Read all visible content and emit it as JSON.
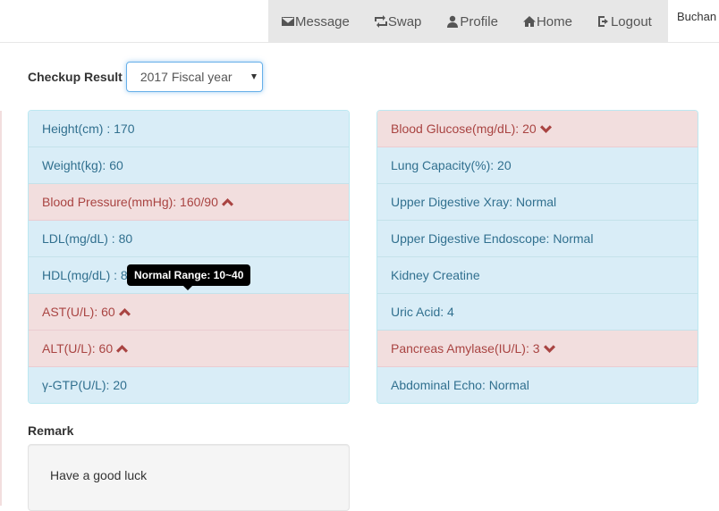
{
  "nav": {
    "items": [
      {
        "label": "Message",
        "icon": "envelope-icon"
      },
      {
        "label": "Swap",
        "icon": "retweet-icon"
      },
      {
        "label": "Profile",
        "icon": "user-icon"
      },
      {
        "label": "Home",
        "icon": "home-icon"
      },
      {
        "label": "Logout",
        "icon": "logout-icon"
      }
    ],
    "user": "Buchan"
  },
  "checkup": {
    "label": "Checkup Result",
    "selected": "2017 Fiscal year"
  },
  "left_list": [
    {
      "text": "Height(cm) : 170",
      "status": "normal"
    },
    {
      "text": "Weight(kg): 60",
      "status": "normal"
    },
    {
      "text": "Blood Pressure(mmHg): 160/90",
      "status": "high"
    },
    {
      "text": "LDL(mg/dL) : 80",
      "status": "normal"
    },
    {
      "text": "HDL(mg/dL) : 8",
      "status": "normal"
    },
    {
      "text": "AST(U/L): 60",
      "status": "high"
    },
    {
      "text": "ALT(U/L): 60",
      "status": "high"
    },
    {
      "text": "γ-GTP(U/L): 20",
      "status": "normal"
    }
  ],
  "right_list": [
    {
      "text": "Blood Glucose(mg/dL): 20",
      "status": "low"
    },
    {
      "text": "Lung Capacity(%): 20",
      "status": "normal"
    },
    {
      "text": "Upper Digestive Xray: Normal",
      "status": "normal"
    },
    {
      "text": "Upper Digestive Endoscope: Normal",
      "status": "normal"
    },
    {
      "text": "Kidney Creatine",
      "status": "normal"
    },
    {
      "text": "Uric Acid: 4",
      "status": "normal"
    },
    {
      "text": "Pancreas Amylase(IU/L): 3",
      "status": "low"
    },
    {
      "text": "Abdominal Echo: Normal",
      "status": "normal"
    }
  ],
  "tooltip": "Normal Range: 10~40",
  "remark": {
    "label": "Remark",
    "text": "Have a good luck"
  }
}
